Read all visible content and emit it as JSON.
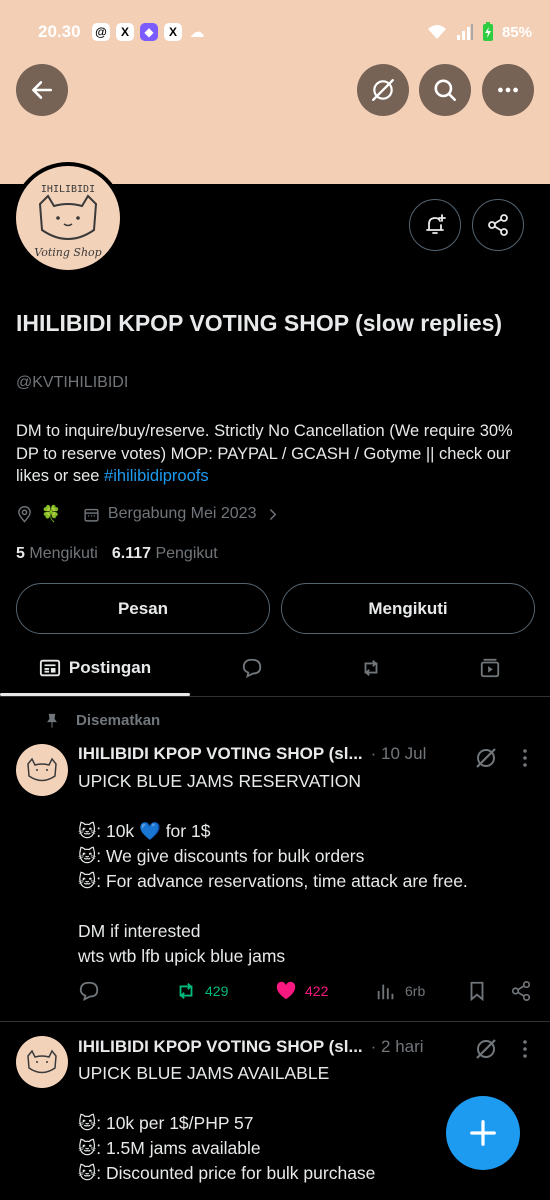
{
  "status_bar": {
    "time": "20.30",
    "app_icons": [
      "threads-icon",
      "x-icon",
      "notification-icon",
      "x-icon",
      "cloud-icon"
    ],
    "battery": "85%"
  },
  "header": {
    "back_icon": "arrow-left-icon",
    "grok_icon": "grok-icon",
    "search_icon": "search-icon",
    "more_icon": "more-horizontal-icon",
    "banner_color": "#f3cfb6"
  },
  "avatar": {
    "top_text": "IHILIBIDI",
    "bottom_text": "Voting Shop"
  },
  "profile": {
    "name": "IHILIBIDI KPOP VOTING SHOP (slow replies)",
    "handle": "@KVTIHILIBIDI",
    "bio": "DM to inquire/buy/reserve. Strictly No Cancellation (We require 30% DP to reserve votes) MOP: PAYPAL / GCASH / Gotyme || check our likes or see",
    "bio_hashtag": "#ihilibidiproofs",
    "location_emoji": "🍀",
    "joined": "Bergabung Mei 2023",
    "following_count": "5",
    "following_label": "Mengikuti",
    "followers_count": "6.117",
    "followers_label": "Pengikut",
    "message_button": "Pesan",
    "following_button": "Mengikuti"
  },
  "tabs": {
    "active_label": "Postingan",
    "icons": [
      "posts-icon",
      "replies-icon",
      "reposts-icon",
      "media-icon"
    ]
  },
  "pinned_label": "Disematkan",
  "posts": [
    {
      "author": "IHILIBIDI KPOP VOTING SHOP (sl...",
      "date": "· 10 Jul",
      "lines": [
        "UPICK BLUE JAMS RESERVATION",
        "",
        "🐱: 10k 💙 for 1$",
        "🐱: We give discounts for bulk orders",
        "🐱: For advance reservations, time attack are free.",
        "",
        "DM if interested",
        "wts wtb lfb upick blue jams"
      ],
      "reposts": "429",
      "likes": "422",
      "views": "6rb"
    },
    {
      "author": "IHILIBIDI KPOP VOTING SHOP (sl...",
      "date": "· 2 hari",
      "lines": [
        "UPICK BLUE JAMS AVAILABLE",
        "",
        "🐱: 10k per 1$/PHP 57",
        "🐱: 1.5M jams available",
        "🐱: Discounted price for bulk purchase"
      ]
    }
  ],
  "colors": {
    "accent": "#1d9bf0",
    "repost_active": "#00ba7c",
    "like_active": "#f91880"
  }
}
